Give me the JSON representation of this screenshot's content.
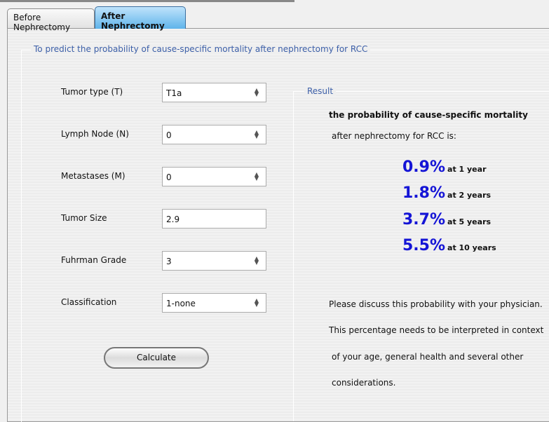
{
  "tabs": [
    {
      "label": "Before Nephrectomy",
      "active": false
    },
    {
      "label": "After Nephrectomy",
      "active": true
    }
  ],
  "form": {
    "title": "To predict the probability of cause-specific mortality after nephrectomy for RCC",
    "fields": [
      {
        "label": "Tumor type (T)",
        "value": "T1a",
        "type": "spinner"
      },
      {
        "label": "Lymph Node (N)",
        "value": "0",
        "type": "spinner"
      },
      {
        "label": "Metastases (M)",
        "value": "0",
        "type": "spinner"
      },
      {
        "label": "Tumor Size",
        "value": "2.9",
        "type": "text"
      },
      {
        "label": "Fuhrman Grade",
        "value": "3",
        "type": "spinner"
      },
      {
        "label": "Classification",
        "value": "1-none",
        "type": "spinner"
      }
    ],
    "calculate_label": "Calculate"
  },
  "result": {
    "title": "Result",
    "heading": "the probability of cause-specific mortality",
    "subheading": "after nephrectomy for RCC is:",
    "rows": [
      {
        "value": "0.9%",
        "period": "at 1 year"
      },
      {
        "value": "1.8%",
        "period": "at 2 years"
      },
      {
        "value": "3.7%",
        "period": "at 5 years"
      },
      {
        "value": "5.5%",
        "period": "at 10 years"
      }
    ],
    "notes": [
      "Please discuss this probability with your physician.",
      "This percentage needs to be interpreted in context",
      "of your age, general health and several other",
      "considerations."
    ]
  },
  "colors": {
    "result_value": "#1414d6",
    "group_title": "#3c5fa8",
    "active_tab": "#5fb4ea"
  }
}
